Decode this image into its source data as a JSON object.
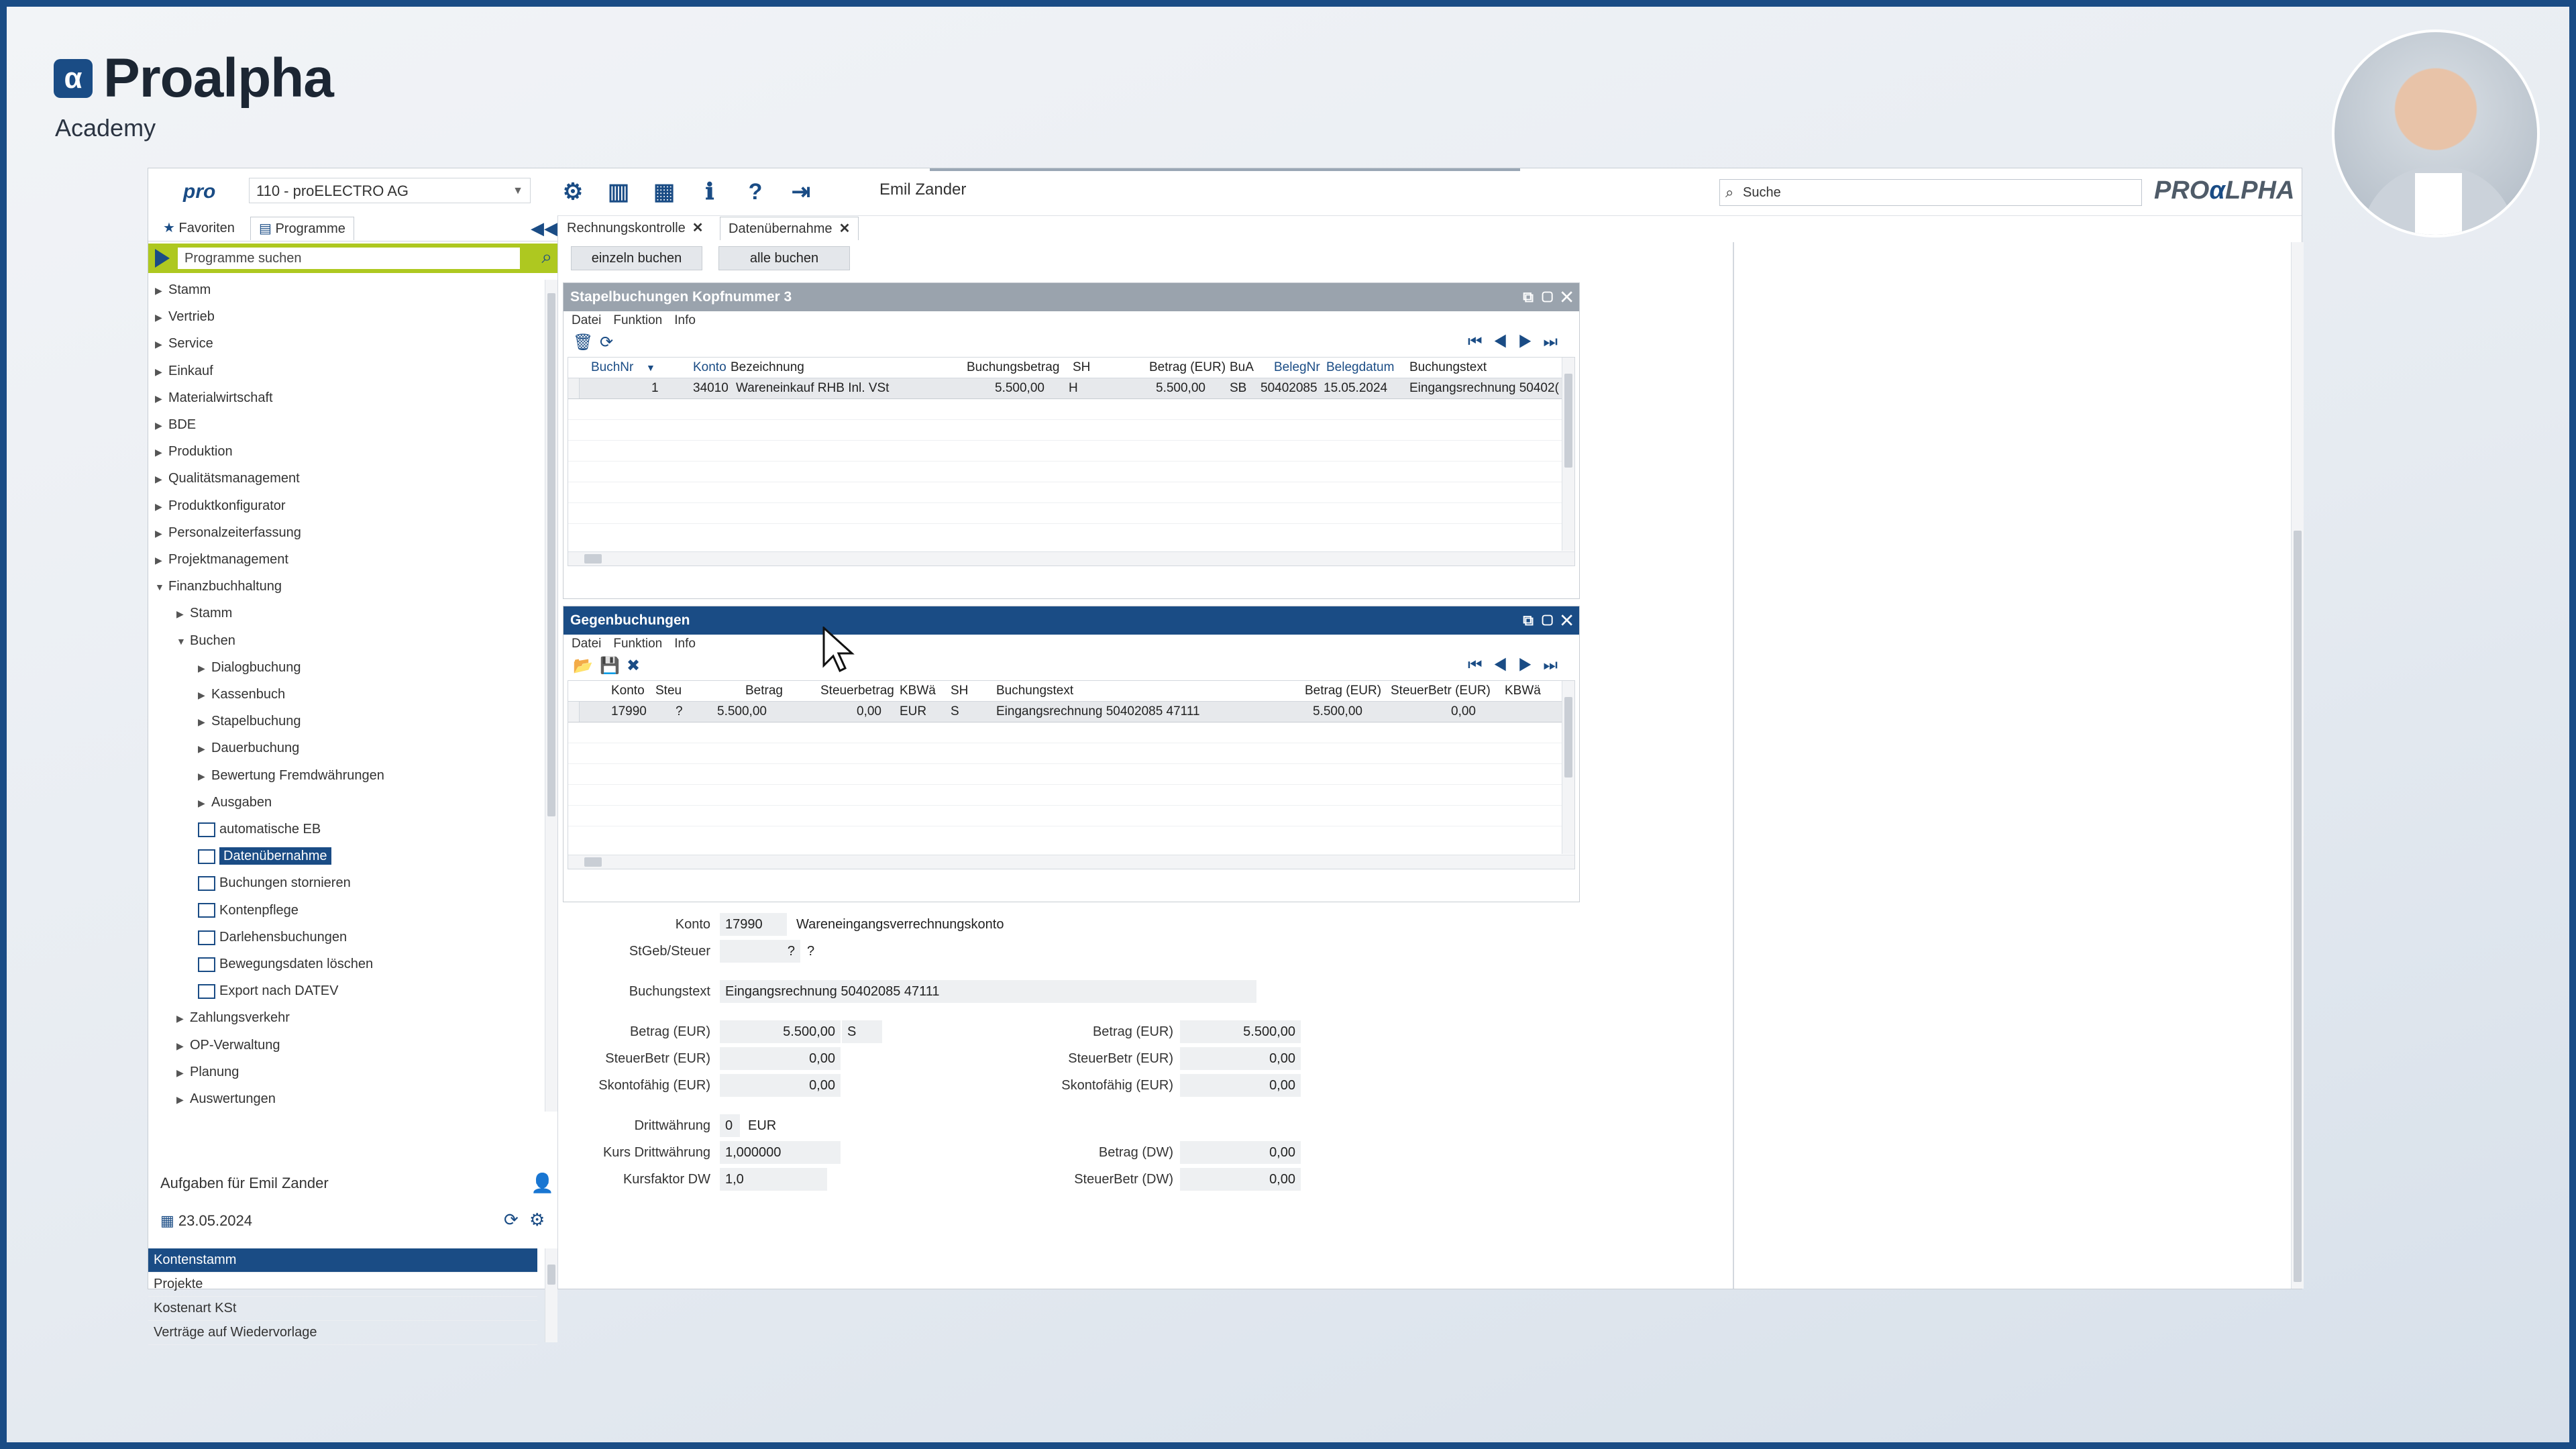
{
  "brand": {
    "logo_letter": "α",
    "title": "Proalpha",
    "subtitle": "Academy"
  },
  "topbar": {
    "pro_label": "pro",
    "company": "110 - proELECTRO AG",
    "user": "Emil Zander",
    "search_placeholder": "Suche",
    "brand_left": "PRO",
    "brand_mid": "α",
    "brand_right": "LPHA"
  },
  "sidebar": {
    "tab_favoriten": "Favoriten",
    "tab_programme": "Programme",
    "search_placeholder": "Programme suchen",
    "tree": [
      {
        "label": "Stamm",
        "level": 0,
        "state": "closed"
      },
      {
        "label": "Vertrieb",
        "level": 0,
        "state": "closed"
      },
      {
        "label": "Service",
        "level": 0,
        "state": "closed"
      },
      {
        "label": "Einkauf",
        "level": 0,
        "state": "closed"
      },
      {
        "label": "Materialwirtschaft",
        "level": 0,
        "state": "closed"
      },
      {
        "label": "BDE",
        "level": 0,
        "state": "closed"
      },
      {
        "label": "Produktion",
        "level": 0,
        "state": "closed"
      },
      {
        "label": "Qualitätsmanagement",
        "level": 0,
        "state": "closed"
      },
      {
        "label": "Produktkonfigurator",
        "level": 0,
        "state": "closed"
      },
      {
        "label": "Personalzeiterfassung",
        "level": 0,
        "state": "closed"
      },
      {
        "label": "Projektmanagement",
        "level": 0,
        "state": "closed"
      },
      {
        "label": "Finanzbuchhaltung",
        "level": 0,
        "state": "open"
      },
      {
        "label": "Stamm",
        "level": 1,
        "state": "closed"
      },
      {
        "label": "Buchen",
        "level": 1,
        "state": "open"
      },
      {
        "label": "Dialogbuchung",
        "level": 2,
        "state": "closed"
      },
      {
        "label": "Kassenbuch",
        "level": 2,
        "state": "closed"
      },
      {
        "label": "Stapelbuchung",
        "level": 2,
        "state": "closed"
      },
      {
        "label": "Dauerbuchung",
        "level": 2,
        "state": "closed"
      },
      {
        "label": "Bewertung Fremdwährungen",
        "level": 2,
        "state": "closed"
      },
      {
        "label": "Ausgaben",
        "level": 2,
        "state": "closed"
      },
      {
        "label": "automatische EB",
        "level": 2,
        "state": "leaf"
      },
      {
        "label": "Datenübernahme",
        "level": 2,
        "state": "leaf",
        "selected": true
      },
      {
        "label": "Buchungen stornieren",
        "level": 2,
        "state": "leaf"
      },
      {
        "label": "Kontenpflege",
        "level": 2,
        "state": "leaf"
      },
      {
        "label": "Darlehensbuchungen",
        "level": 2,
        "state": "leaf"
      },
      {
        "label": "Bewegungsdaten löschen",
        "level": 2,
        "state": "leaf"
      },
      {
        "label": "Export nach DATEV",
        "level": 2,
        "state": "leaf"
      },
      {
        "label": "Zahlungsverkehr",
        "level": 1,
        "state": "closed"
      },
      {
        "label": "OP-Verwaltung",
        "level": 1,
        "state": "closed"
      },
      {
        "label": "Planung",
        "level": 1,
        "state": "closed"
      },
      {
        "label": "Auswertungen",
        "level": 1,
        "state": "closed"
      }
    ],
    "tasks_title": "Aufgaben für Emil Zander",
    "tasks_date": "23.05.2024",
    "tasks": [
      "Kontenstamm",
      "Projekte",
      "Kostenart KSt",
      "Verträge auf Wiedervorlage"
    ]
  },
  "main": {
    "tab1": "Rechnungskontrolle",
    "tab2": "Datenübernahme",
    "btn_einzeln": "einzeln buchen",
    "btn_alle": "alle buchen",
    "menu_datei": "Datei",
    "menu_funktion": "Funktion",
    "menu_info": "Info",
    "panel1": {
      "title": "Stapelbuchungen Kopfnummer 3",
      "cols": {
        "buchnr": "BuchNr",
        "konto": "Konto",
        "bezeichnung": "Bezeichnung",
        "betrag": "Buchungsbetrag",
        "sh": "SH",
        "betrag_eur": "Betrag (EUR)",
        "bua": "BuA",
        "belegnr": "BelegNr",
        "belegdatum": "Belegdatum",
        "text": "Buchungstext"
      },
      "row": {
        "buchnr": "1",
        "konto": "34010",
        "bezeichnung": "Wareneinkauf RHB Inl. VSt",
        "betrag": "5.500,00",
        "sh": "H",
        "betrag_eur": "5.500,00",
        "bua": "SB",
        "belegnr": "50402085",
        "belegdatum": "15.05.2024",
        "text": "Eingangsrechnung 50402("
      }
    },
    "panel2": {
      "title": "Gegenbuchungen",
      "cols": {
        "konto": "Konto",
        "steu": "Steu",
        "betrag": "Betrag",
        "steuerbetrag": "Steuerbetrag",
        "kbwa": "KBWä",
        "sh": "SH",
        "text": "Buchungstext",
        "betrag_eur": "Betrag (EUR)",
        "steuerbetr_eur": "SteuerBetr (EUR)",
        "kbwa2": "KBWä"
      },
      "row": {
        "konto": "17990",
        "steu": "?",
        "betrag": "5.500,00",
        "steuerbetrag": "0,00",
        "kbwa": "EUR",
        "sh": "S",
        "text": "Eingangsrechnung 50402085 47111",
        "betrag_eur": "5.500,00",
        "steuerbetr_eur": "0,00"
      }
    },
    "form": {
      "konto_label": "Konto",
      "konto": "17990",
      "konto_name": "Wareneingangsverrechnungskonto",
      "stgeb_label": "StGeb/Steuer",
      "stgeb_a": "?",
      "stgeb_b": "?",
      "buchungstext_label": "Buchungstext",
      "buchungstext": "Eingangsrechnung 50402085 47111",
      "betrag_eur_label": "Betrag (EUR)",
      "betrag_eur": "5.500,00",
      "sh": "S",
      "steuerbetr_label": "SteuerBetr (EUR)",
      "steuerbetr": "0,00",
      "skonto_label": "Skontofähig (EUR)",
      "skonto": "0,00",
      "r_betrag_label": "Betrag (EUR)",
      "r_betrag": "5.500,00",
      "r_steuerbetr_label": "SteuerBetr (EUR)",
      "r_steuerbetr": "0,00",
      "r_skonto_label": "Skontofähig (EUR)",
      "r_skonto": "0,00",
      "dritt_label": "Drittwährung",
      "dritt_code": "0",
      "dritt_cur": "EUR",
      "kurs_label": "Kurs Drittwährung",
      "kurs": "1,000000",
      "kursfaktor_label": "Kursfaktor DW",
      "kursfaktor": "1,0",
      "betrag_dw_label": "Betrag (DW)",
      "betrag_dw": "0,00",
      "steuerbetr_dw_label": "SteuerBetr (DW)",
      "steuerbetr_dw": "0,00"
    }
  }
}
